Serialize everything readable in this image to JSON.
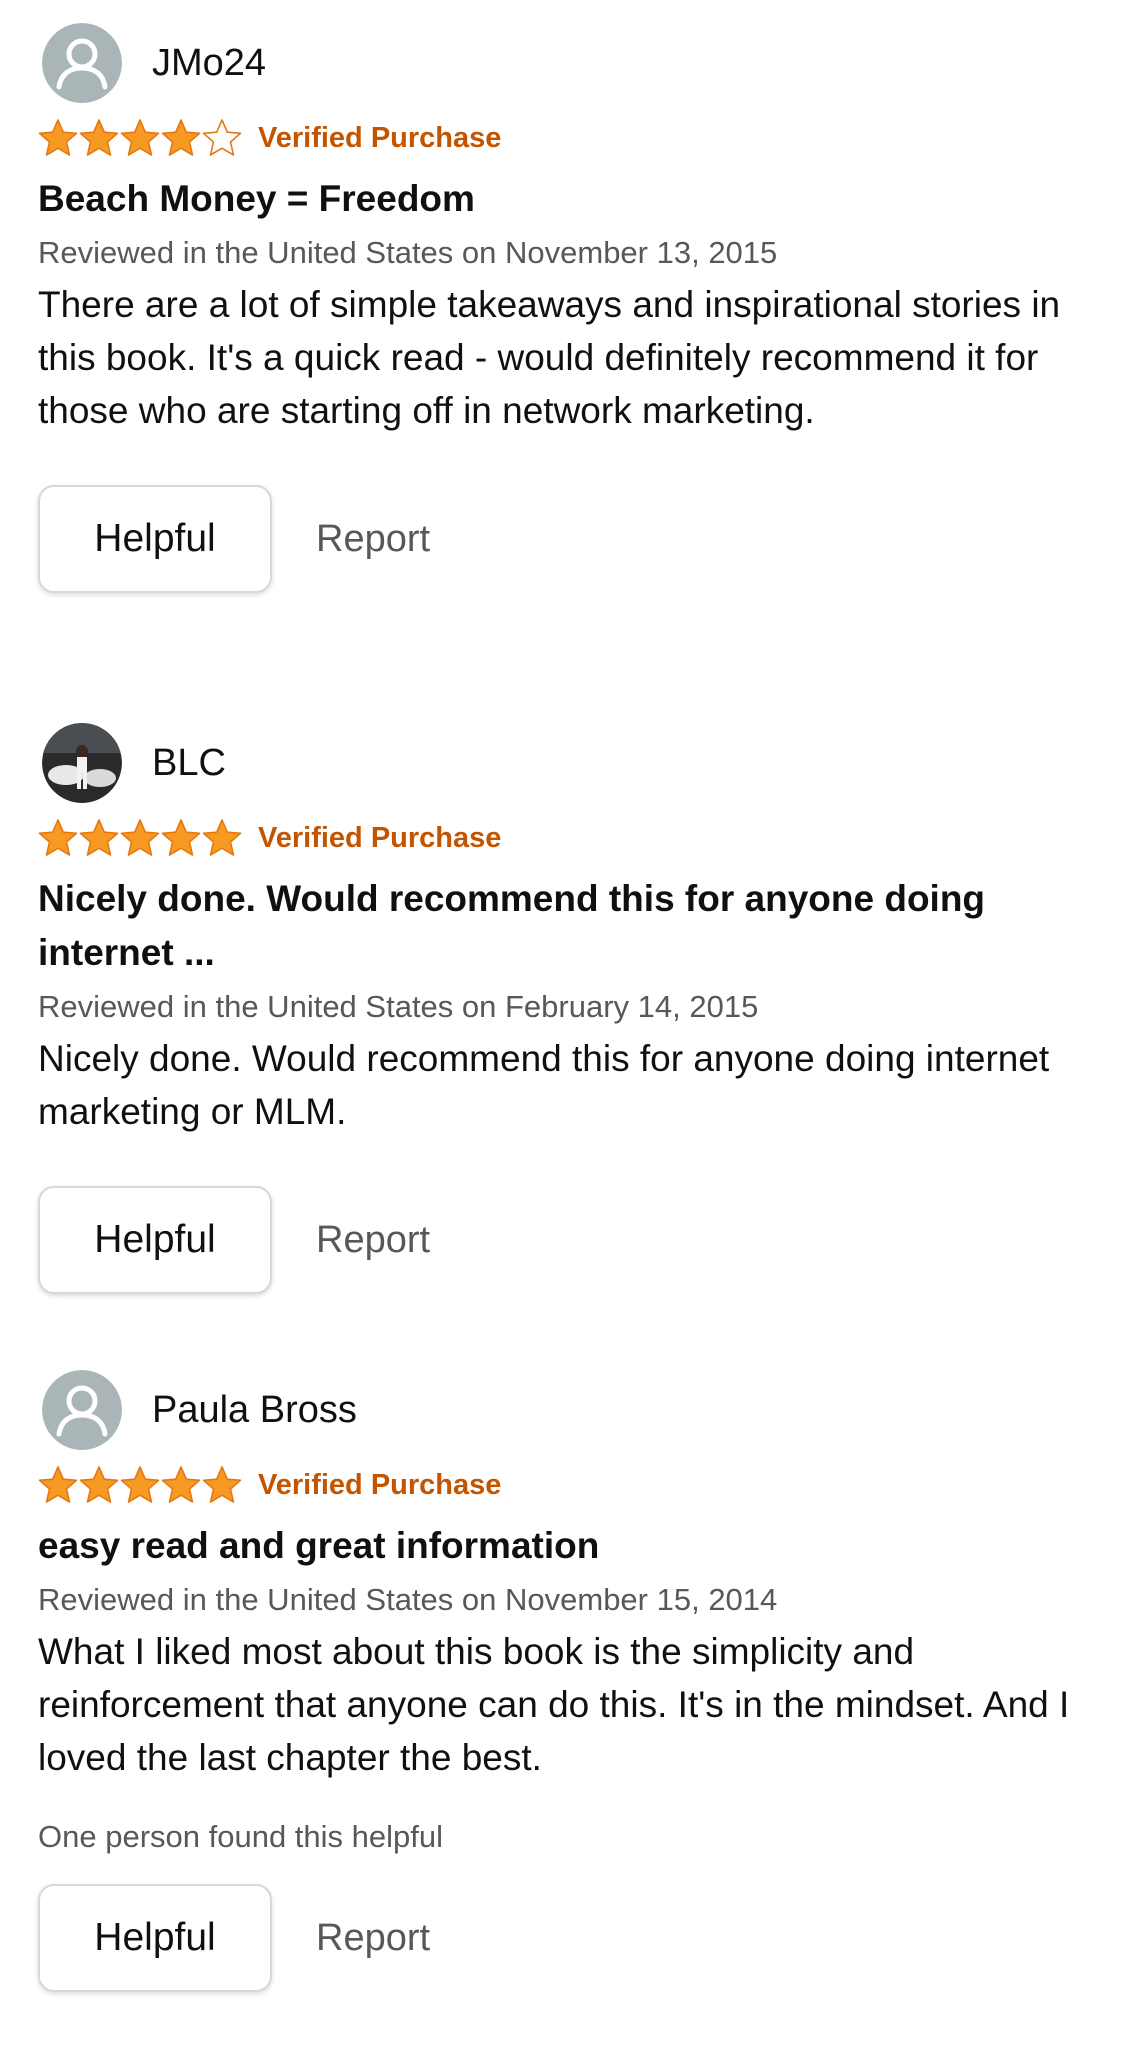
{
  "colors": {
    "star": "#f79a23",
    "star_outline": "#e47911",
    "verified": "#c45500",
    "secondary_text": "#565959"
  },
  "reviews": [
    {
      "reviewer": "JMo24",
      "avatar": "default-person-icon",
      "rating": 4,
      "rating_max": 5,
      "verified": "Verified Purchase",
      "title": "Beach Money = Freedom",
      "date": "Reviewed in the United States on November 13, 2015",
      "body": "There are a lot of simple takeaways and inspirational stories in this book. It's a quick read - would definitely recommend it for those who are starting off in network marketing.",
      "helpful_label": "Helpful",
      "report_label": "Report"
    },
    {
      "reviewer": "BLC",
      "avatar": "profile-photo",
      "rating": 5,
      "rating_max": 5,
      "verified": "Verified Purchase",
      "title": "Nicely done. Would recommend this for anyone doing internet ...",
      "date": "Reviewed in the United States on February 14, 2015",
      "body": "Nicely done. Would recommend this for anyone doing internet marketing or MLM.",
      "helpful_label": "Helpful",
      "report_label": "Report"
    },
    {
      "reviewer": "Paula Bross",
      "avatar": "default-person-icon",
      "rating": 5,
      "rating_max": 5,
      "verified": "Verified Purchase",
      "title": "easy read and great information",
      "date": "Reviewed in the United States on November 15, 2014",
      "body": "What I liked most about this book is the simplicity and reinforcement that anyone can do this. It's in the mindset. And I loved the last chapter the best.",
      "helpful_count": "One person found this helpful",
      "helpful_label": "Helpful",
      "report_label": "Report"
    }
  ]
}
